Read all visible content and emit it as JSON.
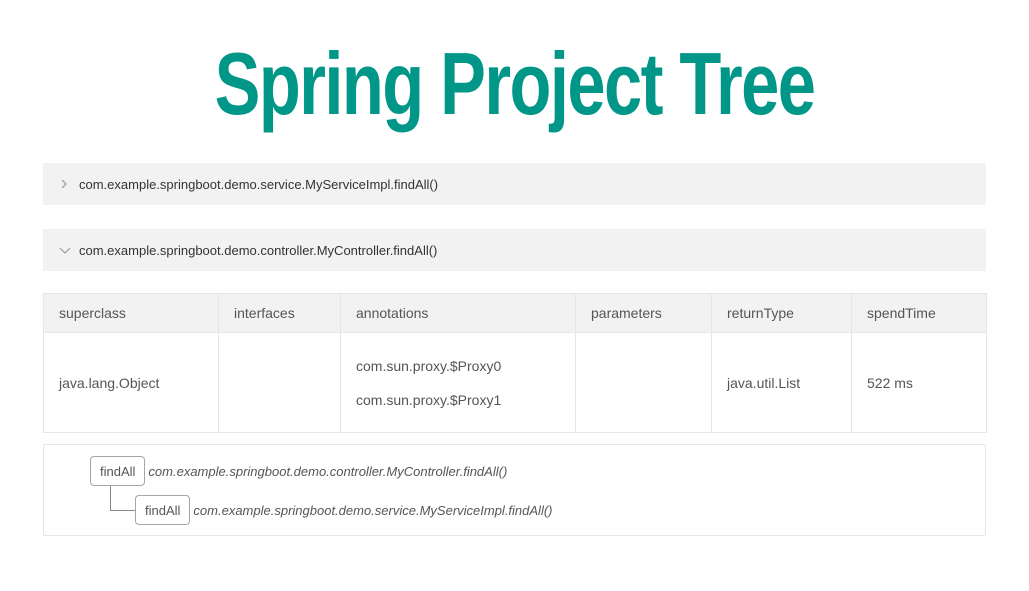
{
  "title": "Spring Project Tree",
  "colors": {
    "accent": "#009688",
    "header_bg": "#f2f2f2",
    "border": "#e6e6e6"
  },
  "panels": [
    {
      "label": "com.example.springboot.demo.service.MyServiceImpl.findAll()",
      "expanded": false,
      "icon": "chevron-right-icon"
    },
    {
      "label": "com.example.springboot.demo.controller.MyController.findAll()",
      "expanded": true,
      "icon": "chevron-down-icon"
    }
  ],
  "table": {
    "headers": [
      "superclass",
      "interfaces",
      "annotations",
      "parameters",
      "returnType",
      "spendTime"
    ],
    "row": {
      "superclass": "java.lang.Object",
      "interfaces": "",
      "annotations": [
        "com.sun.proxy.$Proxy0",
        "com.sun.proxy.$Proxy1"
      ],
      "parameters": "",
      "returnType": "java.util.List",
      "spendTime": "522 ms"
    }
  },
  "tree": {
    "nodes": [
      {
        "label": "findAll",
        "path": "com.example.springboot.demo.controller.MyController.findAll()"
      },
      {
        "label": "findAll",
        "path": "com.example.springboot.demo.service.MyServiceImpl.findAll()"
      }
    ]
  }
}
